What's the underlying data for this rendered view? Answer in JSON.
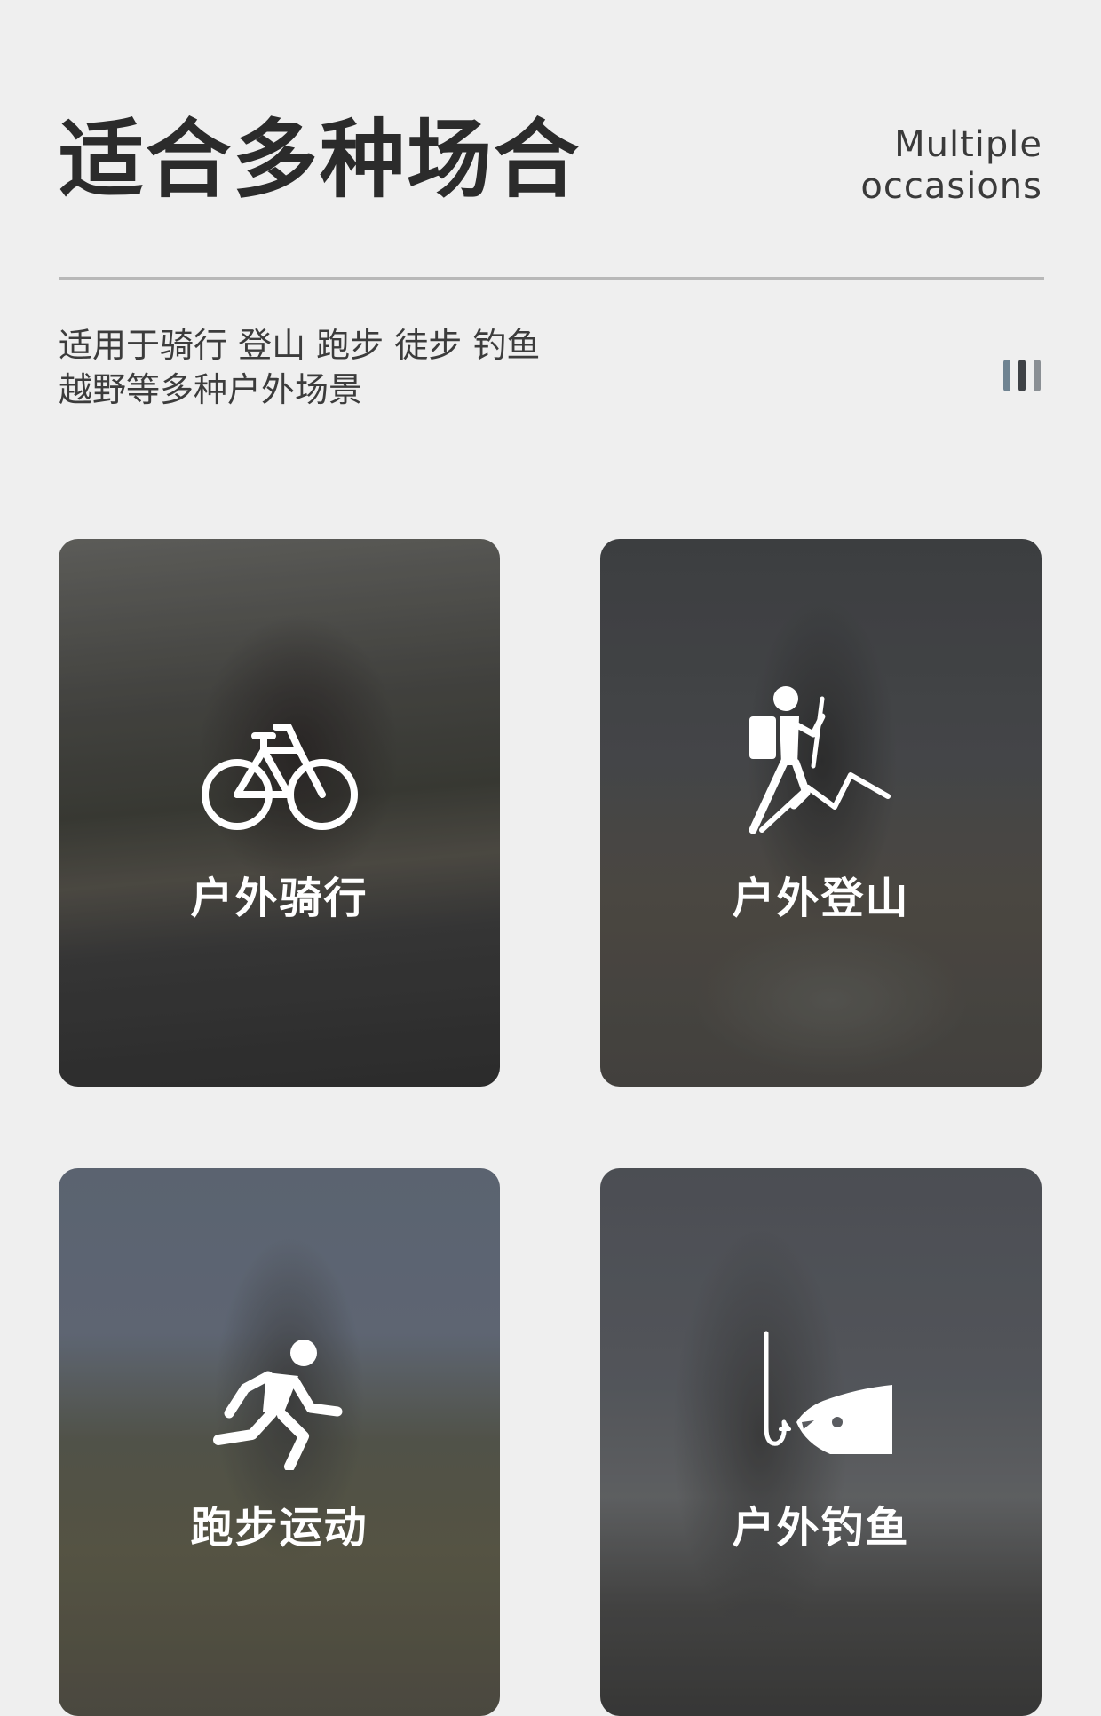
{
  "header": {
    "title": "适合多种场合",
    "subtitle_en_line1": "Multiple",
    "subtitle_en_line2": "occasions"
  },
  "description": {
    "line1": "适用于骑行 登山 跑步 徒步 钓鱼",
    "line2": "越野等多种户外场景"
  },
  "cards": [
    {
      "label": "户外骑行",
      "icon": "bicycle-icon"
    },
    {
      "label": "户外登山",
      "icon": "hiker-icon"
    },
    {
      "label": "跑步运动",
      "icon": "runner-icon"
    },
    {
      "label": "户外钓鱼",
      "icon": "fishing-icon"
    }
  ]
}
